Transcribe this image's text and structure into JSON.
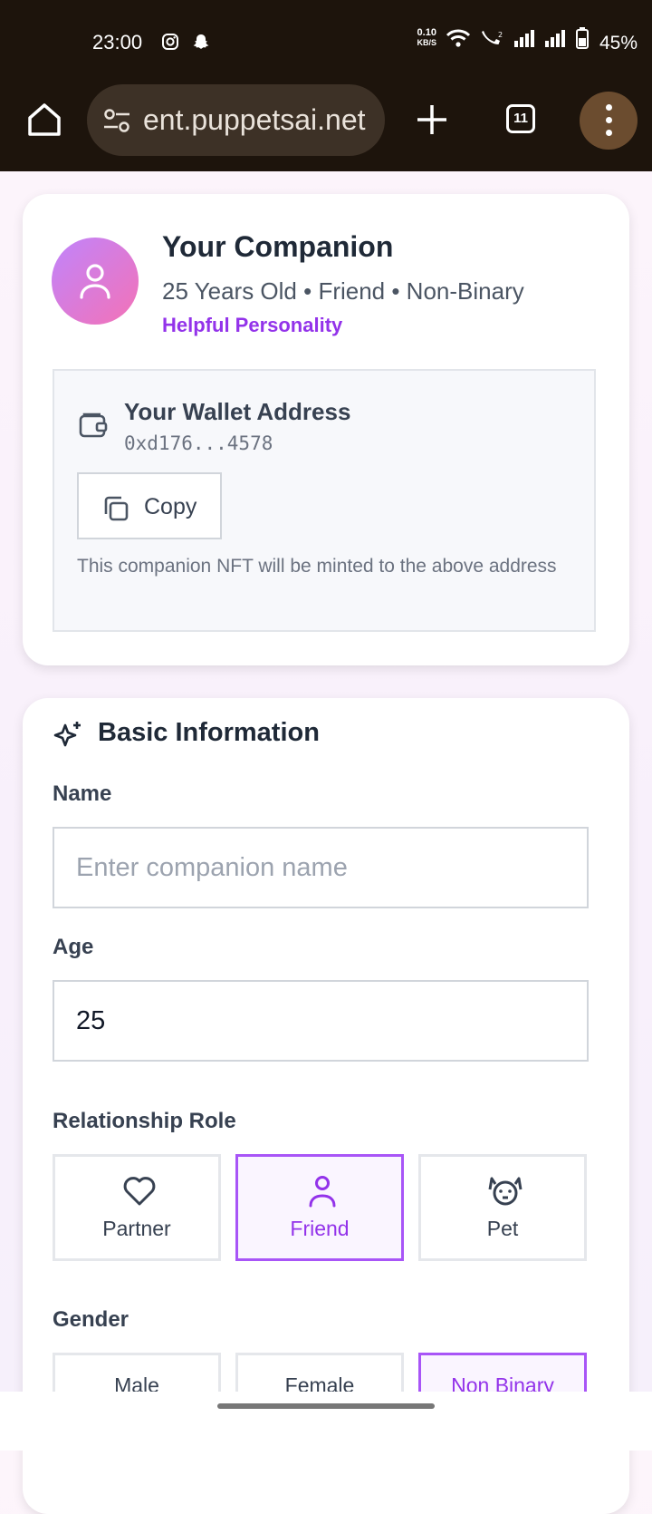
{
  "status_bar": {
    "time": "23:00",
    "net_speed_value": "0.10",
    "net_speed_unit": "KB/S",
    "battery": "45%"
  },
  "browser": {
    "url": "ent.puppetsai.net",
    "tab_count": "11",
    "icons": [
      "home-icon",
      "site-settings-icon",
      "plus-icon",
      "tabs-icon",
      "more-vert-icon"
    ]
  },
  "companion": {
    "title": "Your Companion",
    "subtitle": "25 Years Old • Friend • Non-Binary",
    "personality": "Helpful Personality",
    "wallet": {
      "label": "Your Wallet Address",
      "address": "0xd176...4578",
      "copy_label": "Copy",
      "note": "This companion NFT will be minted to the above address"
    }
  },
  "form": {
    "section_title": "Basic Information",
    "name": {
      "label": "Name",
      "placeholder": "Enter companion name",
      "value": ""
    },
    "age": {
      "label": "Age",
      "value": "25"
    },
    "role": {
      "label": "Relationship Role",
      "options": [
        {
          "label": "Partner",
          "icon": "heart-icon"
        },
        {
          "label": "Friend",
          "icon": "user-icon"
        },
        {
          "label": "Pet",
          "icon": "dog-icon"
        }
      ],
      "selected": "Friend"
    },
    "gender": {
      "label": "Gender",
      "options": [
        "Male",
        "Female",
        "Non Binary"
      ],
      "selected": "Non Binary"
    }
  },
  "colors": {
    "accent": "#9333ea",
    "accent_border": "#a855f7",
    "browser_bg": "#1d140c"
  }
}
